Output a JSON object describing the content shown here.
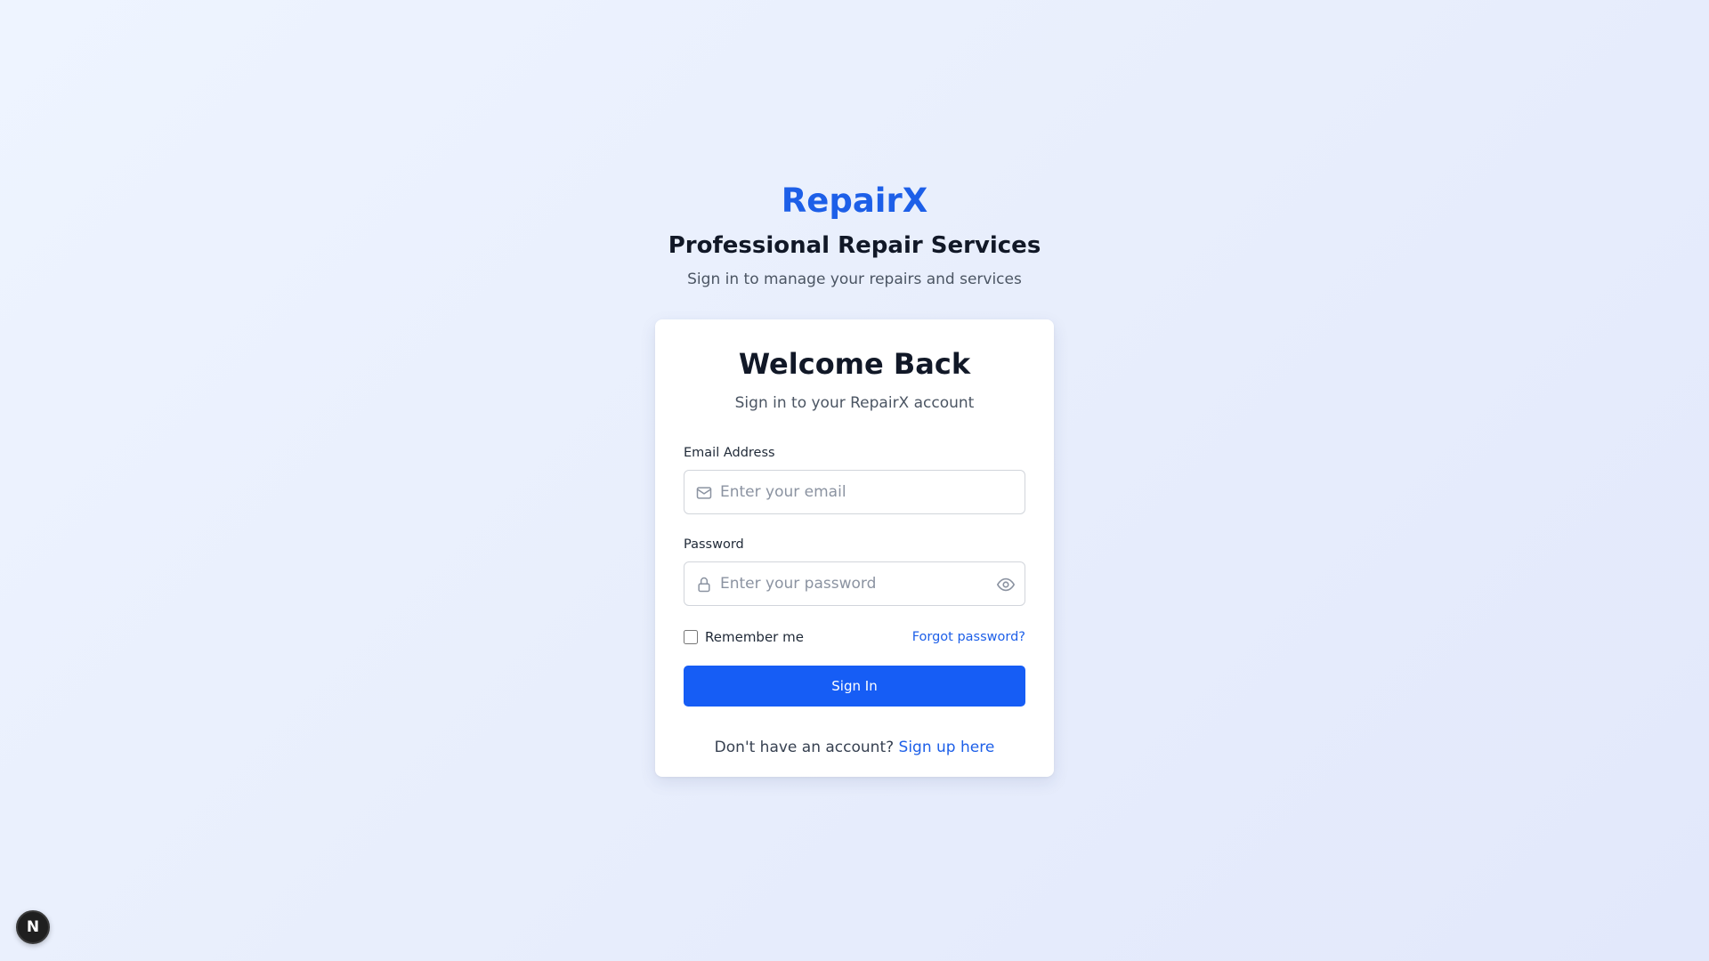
{
  "header": {
    "brand": "RepairX",
    "tagline": "Professional Repair Services",
    "subtitle": "Sign in to manage your repairs and services"
  },
  "card": {
    "title": "Welcome Back",
    "subtitle": "Sign in to your RepairX account"
  },
  "form": {
    "email": {
      "label": "Email Address",
      "placeholder": "Enter your email",
      "value": "",
      "icon": "mail-icon"
    },
    "password": {
      "label": "Password",
      "placeholder": "Enter your password",
      "value": "",
      "icon": "lock-icon",
      "toggle_icon": "eye-icon"
    },
    "remember_label": "Remember me",
    "remember_checked": false,
    "forgot_label": "Forgot password?",
    "submit_label": "Sign In",
    "signup_prompt": "Don't have an account?",
    "signup_link": "Sign up here"
  },
  "badge": {
    "letter": "N"
  },
  "colors": {
    "accent": "#1d5fe8",
    "button": "#165df5"
  }
}
